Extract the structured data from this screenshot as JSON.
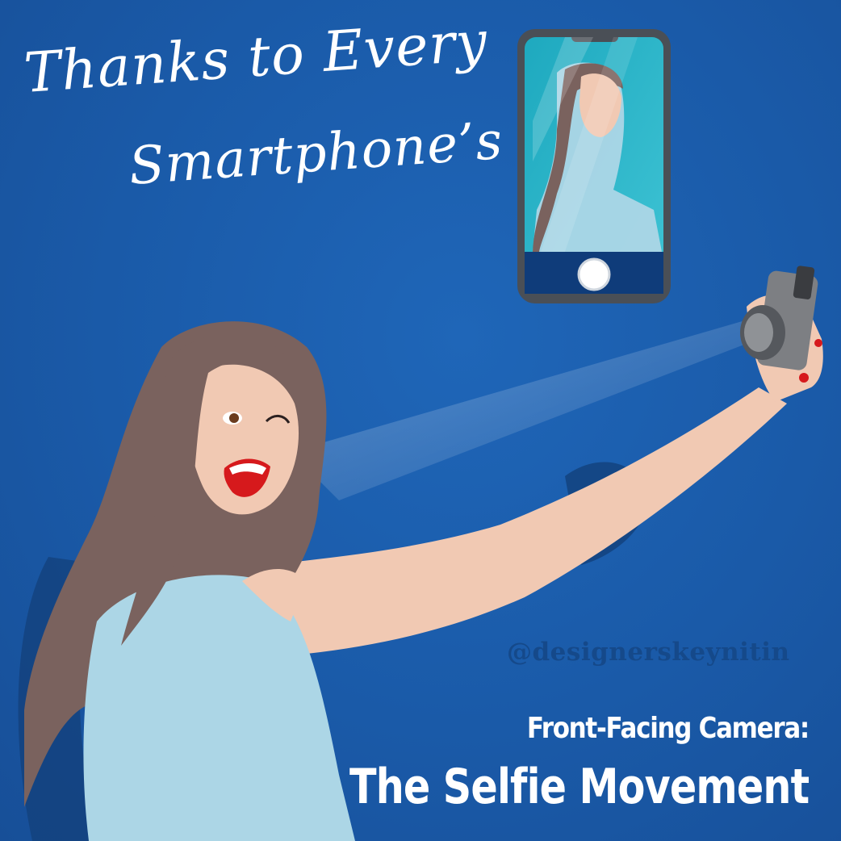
{
  "headline": {
    "script_line_1": "Thanks to Every",
    "script_line_2": "Smartphone’s",
    "subtitle": "Front-Facing Camera:",
    "title": "The Selfie Movement"
  },
  "watermark": {
    "handle": "@designerskeynitin"
  },
  "illustration": {
    "subject": "woman-taking-selfie",
    "objects": [
      "smartphone-screen-preview",
      "camera-in-hand",
      "camera-flash-beam",
      "shutter-button-icon"
    ]
  },
  "colors": {
    "background": "#1a5aa8",
    "hair": "#7a625e",
    "skin": "#f1c9b3",
    "top": "#acd6e6",
    "lips": "#d6191c",
    "phone_frame": "#4a4f56",
    "phone_screen": "#2bb5c9",
    "text": "#ffffff",
    "watermark": "#15498a"
  }
}
